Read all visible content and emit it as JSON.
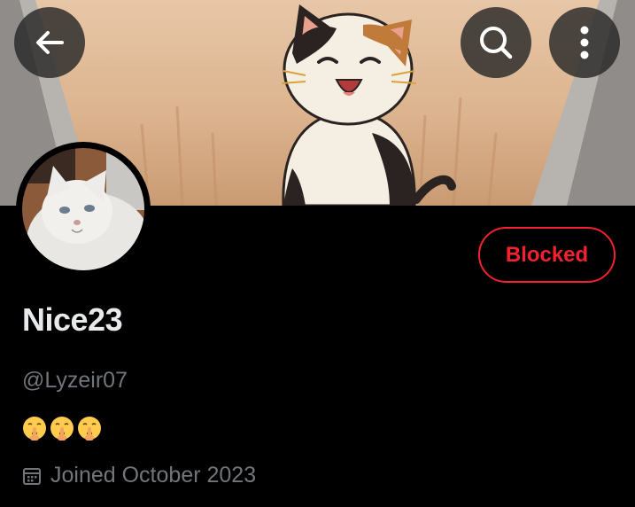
{
  "header": {
    "back_icon": "arrow-left-icon",
    "search_icon": "search-icon",
    "more_icon": "more-vertical-icon"
  },
  "banner": {
    "image": "illustrated smiling calico cat"
  },
  "avatar": {
    "image": "white cat photo"
  },
  "profile": {
    "action_label": "Blocked",
    "action_color": "#f4212e",
    "display_name": "Nice23",
    "handle": "@Lyzeir07",
    "bio_emojis": [
      "shushing-face-emoji",
      "shushing-face-emoji",
      "shushing-face-emoji"
    ],
    "joined_icon": "calendar-icon",
    "joined_text": "Joined October 2023"
  },
  "colors": {
    "background": "#000000",
    "text_primary": "#e7e9ea",
    "text_secondary": "#71767b",
    "blocked": "#f4212e"
  }
}
